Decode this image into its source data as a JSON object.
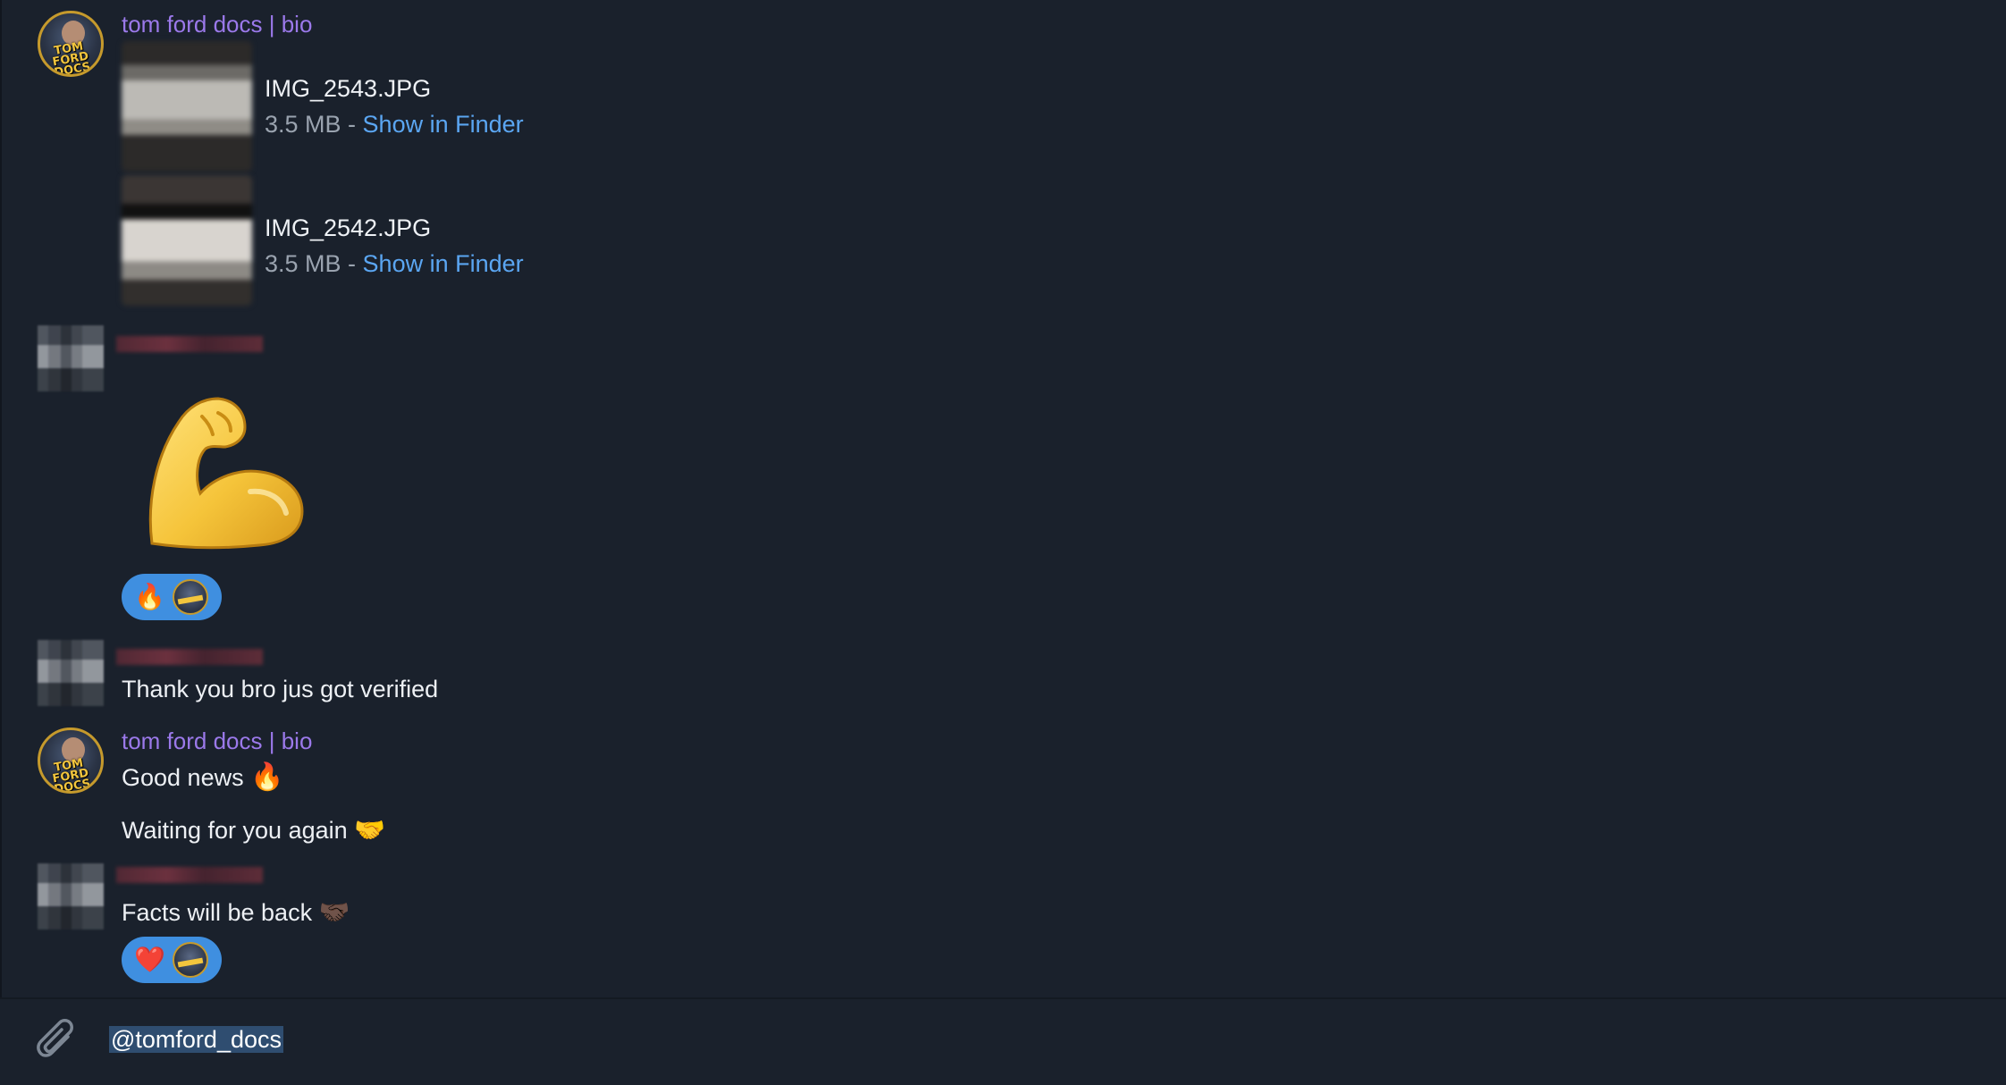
{
  "messages": {
    "group1": {
      "sender": "tom ford docs | bio",
      "files": [
        {
          "name": "IMG_2543.JPG",
          "size": "3.5 MB",
          "separator": " - ",
          "action": "Show in Finder"
        },
        {
          "name": "IMG_2542.JPG",
          "size": "3.5 MB",
          "separator": " - ",
          "action": "Show in Finder"
        }
      ]
    },
    "group2": {
      "sticker": "💪",
      "reaction": {
        "emoji": "🔥"
      }
    },
    "group3": {
      "text": "Thank you bro jus got verified"
    },
    "group4": {
      "sender": "tom ford docs | bio",
      "lines": [
        {
          "text": "Good news",
          "emoji": "🔥"
        },
        {
          "text": "Waiting for you again",
          "emoji": "🤝"
        }
      ]
    },
    "group5": {
      "text": "Facts will be back",
      "emoji": "🤝🏿",
      "reaction": {
        "emoji": "❤️"
      }
    }
  },
  "composer": {
    "value": "@tomford_docs",
    "attach_icon": "paperclip-icon"
  },
  "colors": {
    "background": "#1a212c",
    "sender_name": "#9b79ea",
    "link": "#5ba6f2",
    "reaction_pill": "#3f8fe0",
    "selection": "#2f4d70"
  },
  "avatar_brand_text": "TOM FORD DOCS"
}
